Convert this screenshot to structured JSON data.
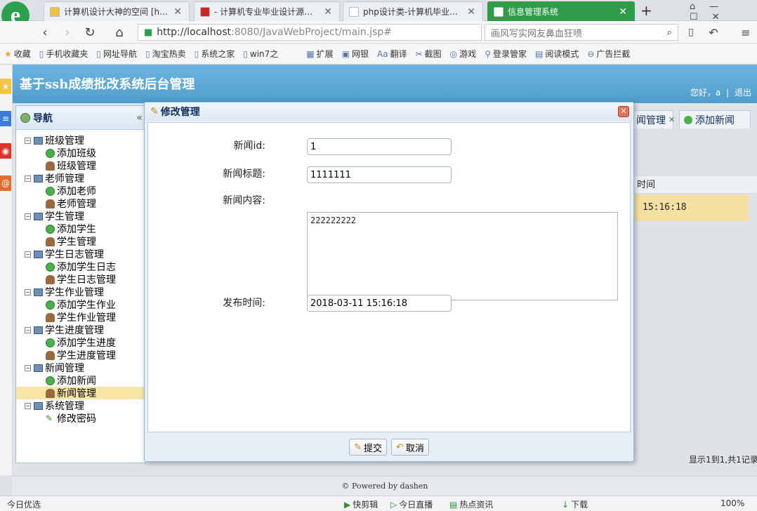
{
  "browser": {
    "tabs": [
      {
        "label": "计算机设计大神的空间 [http",
        "icon_color": "#f0c040",
        "active": false
      },
      {
        "label": "- 计算机专业毕业设计源码网",
        "icon_color": "#c8281e",
        "active": false
      },
      {
        "label": "php设计类-计算机毕业设计",
        "icon_color": "#ffffff",
        "active": false
      },
      {
        "label": "信息管理系统",
        "icon_color": "#2e9c49",
        "active": true
      }
    ],
    "new_tab": "+",
    "url_host": "http://localhost",
    "url_rest": ":8080/JavaWebProject/main.jsp#",
    "search_placeholder": "画风写实网友鼻血狂喷",
    "bookmarks": [
      "收藏",
      "手机收藏夹",
      "网址导航",
      "淘宝热卖",
      "系统之家",
      "win7之"
    ],
    "toolbar_items": [
      "扩展",
      "网银",
      "翻译",
      "截图",
      "游戏",
      "登录管家",
      "阅读模式",
      "广告拦截"
    ]
  },
  "app": {
    "title": "基于ssh成绩批改系统后台管理",
    "welcome": "您好，a",
    "separator": "|",
    "logout": "退出",
    "nav_title": "导航",
    "nav_collapse": "«",
    "tree": [
      {
        "label": "班级管理",
        "children": [
          {
            "label": "添加班级",
            "icon": "add"
          },
          {
            "label": "班级管理",
            "icon": "user"
          }
        ]
      },
      {
        "label": "老师管理",
        "children": [
          {
            "label": "添加老师",
            "icon": "add"
          },
          {
            "label": "老师管理",
            "icon": "user"
          }
        ]
      },
      {
        "label": "学生管理",
        "children": [
          {
            "label": "添加学生",
            "icon": "add"
          },
          {
            "label": "学生管理",
            "icon": "user"
          }
        ]
      },
      {
        "label": "学生日志管理",
        "children": [
          {
            "label": "添加学生日志",
            "icon": "add"
          },
          {
            "label": "学生日志管理",
            "icon": "user"
          }
        ]
      },
      {
        "label": "学生作业管理",
        "children": [
          {
            "label": "添加学生作业",
            "icon": "add"
          },
          {
            "label": "学生作业管理",
            "icon": "user"
          }
        ]
      },
      {
        "label": "学生进度管理",
        "children": [
          {
            "label": "添加学生进度",
            "icon": "add"
          },
          {
            "label": "学生进度管理",
            "icon": "user"
          }
        ]
      },
      {
        "label": "新闻管理",
        "children": [
          {
            "label": "添加新闻",
            "icon": "add"
          },
          {
            "label": "新闻管理",
            "icon": "user",
            "selected": true
          }
        ]
      },
      {
        "label": "系统管理",
        "children": [
          {
            "label": "修改密码",
            "icon": "pen"
          }
        ]
      }
    ],
    "content_tabs": [
      "闻管理",
      "添加新闻"
    ],
    "grid_header": "时间",
    "grid_row_time": "15:16:18",
    "pager_text": "显示1到1,共1记录",
    "footer": "© Powered by dashen"
  },
  "dialog": {
    "title": "修改管理",
    "fields": {
      "id_label": "新闻id:",
      "id_value": "1",
      "title_label": "新闻标题:",
      "title_value": "1111111",
      "content_label": "新闻内容:",
      "content_value": "222222222",
      "time_label": "发布时间:",
      "time_value": "2018-03-11 15:16:18"
    },
    "submit_label": "提交",
    "cancel_label": "取消"
  },
  "statusbar": {
    "left": "今日优选",
    "items": [
      "快剪辑",
      "今日直播",
      "热点资讯",
      "下载",
      "100%"
    ]
  }
}
